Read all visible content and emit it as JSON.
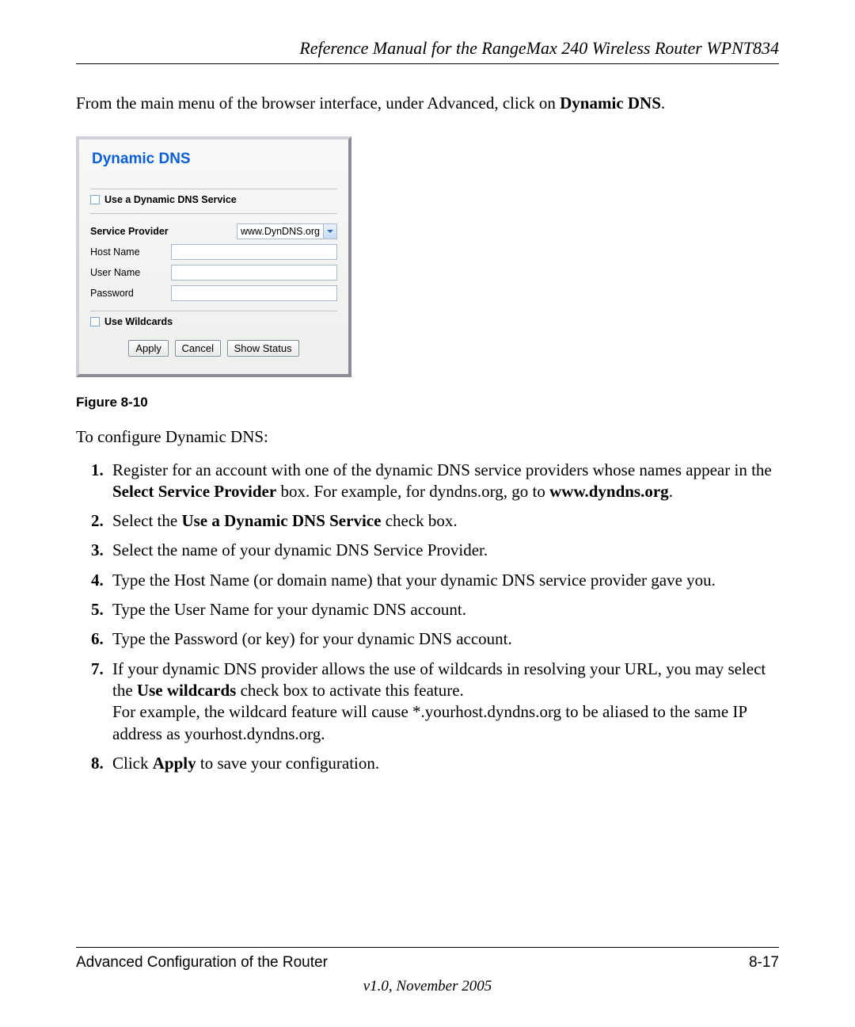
{
  "header": {
    "title": "Reference Manual for the RangeMax 240 Wireless Router WPNT834"
  },
  "intro": {
    "pre": "From the main menu of the browser interface, under Advanced, click on ",
    "bold": "Dynamic DNS",
    "post": "."
  },
  "panel": {
    "heading": "Dynamic DNS",
    "useService": "Use a Dynamic DNS Service",
    "serviceProvider_label": "Service Provider",
    "serviceProvider_value": "www.DynDNS.org",
    "hostName_label": "Host Name",
    "userName_label": "User Name",
    "password_label": "Password",
    "useWildcards": "Use Wildcards",
    "buttons": {
      "apply": "Apply",
      "cancel": "Cancel",
      "showStatus": "Show Status"
    }
  },
  "figure_caption": "Figure 8-10",
  "configure_lead": "To configure Dynamic DNS:",
  "steps": {
    "s1_a": "Register for an account with one of the dynamic DNS service providers whose names appear in the ",
    "s1_b": "Select Service Provider",
    "s1_c": " box. For example, for dyndns.org, go to ",
    "s1_d": "www.dyndns.org",
    "s1_e": ".",
    "s2_a": "Select the ",
    "s2_b": "Use a Dynamic DNS Service",
    "s2_c": " check box.",
    "s3": "Select the name of your dynamic DNS Service Provider.",
    "s4": "Type the Host Name (or domain name) that your dynamic DNS service provider gave you.",
    "s5": "Type the User Name for your dynamic DNS account.",
    "s6": "Type the Password (or key) for your dynamic DNS account.",
    "s7_a": "If your dynamic DNS provider allows the use of wildcards in resolving your URL, you may select the ",
    "s7_b": "Use wildcards",
    "s7_c": " check box to activate this feature.",
    "s7_d": "For example, the wildcard feature will cause *.yourhost.dyndns.org to be aliased to the same IP address as yourhost.dyndns.org.",
    "s8_a": "Click ",
    "s8_b": "Apply",
    "s8_c": " to save your configuration."
  },
  "footer": {
    "chapter": "Advanced Configuration of the Router",
    "page": "8-17",
    "version": "v1.0, November 2005"
  }
}
